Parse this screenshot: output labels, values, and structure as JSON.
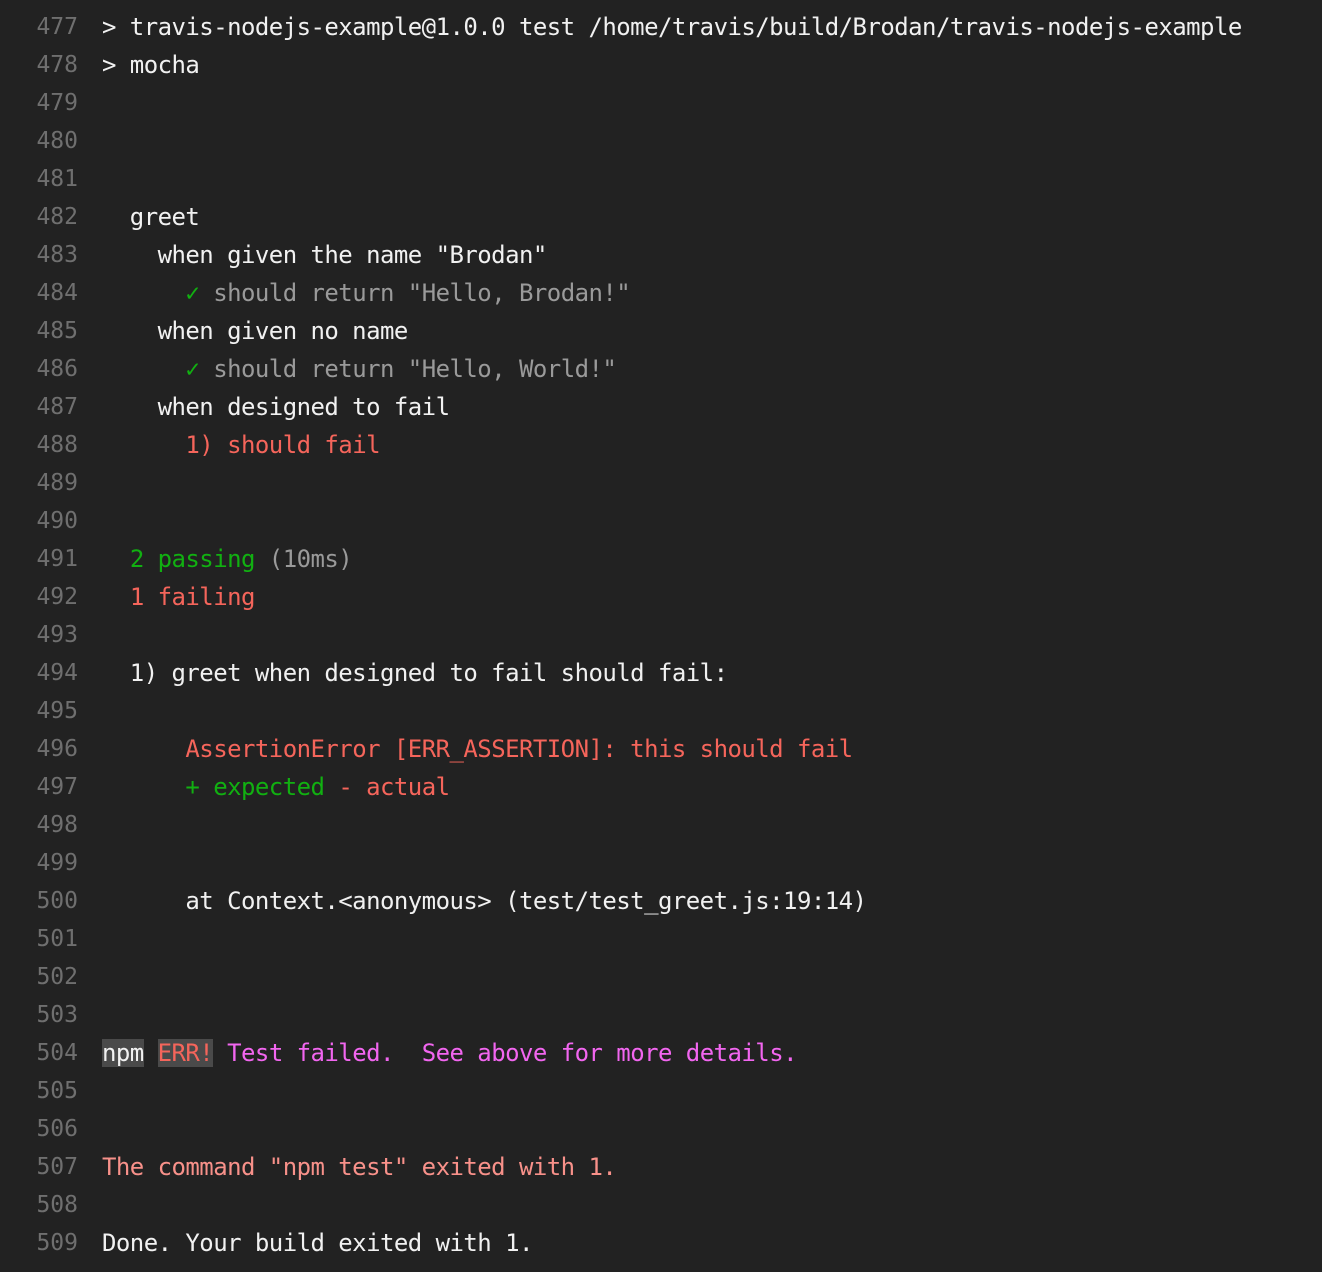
{
  "log": {
    "lines": [
      {
        "n": "477",
        "segs": [
          {
            "t": "> travis-nodejs-example@1.0.0 test /home/travis/build/Brodan/travis-nodejs-example",
            "c": "default"
          }
        ]
      },
      {
        "n": "478",
        "segs": [
          {
            "t": "> mocha",
            "c": "default"
          }
        ]
      },
      {
        "n": "479",
        "segs": []
      },
      {
        "n": "480",
        "segs": []
      },
      {
        "n": "481",
        "segs": []
      },
      {
        "n": "482",
        "segs": [
          {
            "t": "  greet",
            "c": "default"
          }
        ]
      },
      {
        "n": "483",
        "segs": [
          {
            "t": "    when given the name \"Brodan\"",
            "c": "default"
          }
        ]
      },
      {
        "n": "484",
        "segs": [
          {
            "t": "      ",
            "c": "default"
          },
          {
            "t": "✓",
            "c": "green"
          },
          {
            "t": " should return \"Hello, Brodan!\"",
            "c": "gray"
          }
        ]
      },
      {
        "n": "485",
        "segs": [
          {
            "t": "    when given no name",
            "c": "default"
          }
        ]
      },
      {
        "n": "486",
        "segs": [
          {
            "t": "      ",
            "c": "default"
          },
          {
            "t": "✓",
            "c": "green"
          },
          {
            "t": " should return \"Hello, World!\"",
            "c": "gray"
          }
        ]
      },
      {
        "n": "487",
        "segs": [
          {
            "t": "    when designed to fail",
            "c": "default"
          }
        ]
      },
      {
        "n": "488",
        "segs": [
          {
            "t": "      ",
            "c": "default"
          },
          {
            "t": "1) should fail",
            "c": "red"
          }
        ]
      },
      {
        "n": "489",
        "segs": []
      },
      {
        "n": "490",
        "segs": []
      },
      {
        "n": "491",
        "segs": [
          {
            "t": "  ",
            "c": "default"
          },
          {
            "t": "2 passing",
            "c": "green"
          },
          {
            "t": " (10ms)",
            "c": "gray"
          }
        ]
      },
      {
        "n": "492",
        "segs": [
          {
            "t": "  ",
            "c": "default"
          },
          {
            "t": "1 failing",
            "c": "red"
          }
        ]
      },
      {
        "n": "493",
        "segs": []
      },
      {
        "n": "494",
        "segs": [
          {
            "t": "  1) greet when designed to fail should fail:",
            "c": "default"
          }
        ]
      },
      {
        "n": "495",
        "segs": []
      },
      {
        "n": "496",
        "segs": [
          {
            "t": "      ",
            "c": "default"
          },
          {
            "t": "AssertionError [ERR_ASSERTION]: this should fail",
            "c": "red"
          }
        ]
      },
      {
        "n": "497",
        "segs": [
          {
            "t": "      ",
            "c": "default"
          },
          {
            "t": "+ expected",
            "c": "green"
          },
          {
            "t": " ",
            "c": "default"
          },
          {
            "t": "- actual",
            "c": "red"
          }
        ]
      },
      {
        "n": "498",
        "segs": []
      },
      {
        "n": "499",
        "segs": []
      },
      {
        "n": "500",
        "segs": [
          {
            "t": "      at Context.<anonymous> (test/test_greet.js:19:14)",
            "c": "default"
          }
        ]
      },
      {
        "n": "501",
        "segs": []
      },
      {
        "n": "502",
        "segs": []
      },
      {
        "n": "503",
        "segs": []
      },
      {
        "n": "504",
        "segs": [
          {
            "t": "npm",
            "c": "default",
            "bg": "gray"
          },
          {
            "t": " ",
            "c": "default"
          },
          {
            "t": "ERR!",
            "c": "red",
            "bg": "gray"
          },
          {
            "t": " Test failed.  See above for more details.",
            "c": "magenta"
          }
        ]
      },
      {
        "n": "505",
        "segs": []
      },
      {
        "n": "506",
        "segs": []
      },
      {
        "n": "507",
        "segs": [
          {
            "t": "The command \"npm test\" exited with 1.",
            "c": "salmon"
          }
        ]
      },
      {
        "n": "508",
        "segs": []
      },
      {
        "n": "509",
        "segs": [
          {
            "t": "Done. Your build exited with 1.",
            "c": "default"
          }
        ]
      }
    ]
  },
  "colors": {
    "background": "#222222",
    "line_number": "#6f6f6f",
    "default": "#f1f1f1",
    "gray": "#9a9a9a",
    "green": "#11b011",
    "red": "#f5655b",
    "salmon": "#f8918a",
    "magenta": "#f266f0",
    "highlight_bg": "#4a4a4a"
  }
}
